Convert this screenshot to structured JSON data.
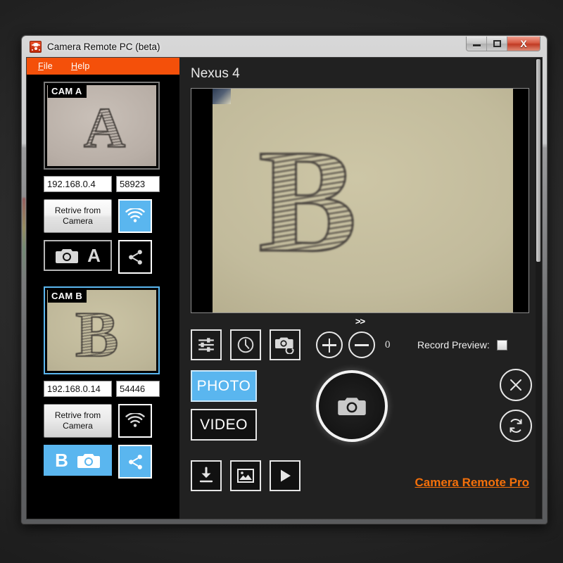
{
  "window": {
    "title": "Camera Remote PC (beta)",
    "app_icon": "camera-app-icon",
    "controls": {
      "minimize": "minimize-icon",
      "maximize": "maximize-icon",
      "close": "X"
    }
  },
  "menu": {
    "items": [
      {
        "label": "File",
        "mnemonic": "F"
      },
      {
        "label": "Help",
        "mnemonic": "H"
      }
    ]
  },
  "sidebar": {
    "cameras": [
      {
        "badge": "CAM A",
        "letter": "A",
        "selected": false,
        "ip": "192.168.0.4",
        "port": "58923",
        "retrieve_label": "Retrive from\nCamera",
        "wifi_active": true,
        "capture_letter": "A",
        "capture_active": false,
        "share_active": false
      },
      {
        "badge": "CAM B",
        "letter": "B",
        "selected": true,
        "ip": "192.168.0.14",
        "port": "54446",
        "retrieve_label": "Retrive from\nCamera",
        "wifi_active": false,
        "capture_letter": "B",
        "capture_active": true,
        "share_active": true
      }
    ]
  },
  "main": {
    "device_title": "Nexus 4",
    "preview_letter": "B",
    "chevron": ">>",
    "controls": {
      "settings_icon": "sliders-icon",
      "timer_icon": "clock-icon",
      "switch_camera_icon": "camera-switch-icon",
      "zoom_in": "plus-icon",
      "zoom_out": "minus-icon",
      "zoom_value": "0",
      "record_preview_label": "Record Preview:",
      "record_preview_checked": false
    },
    "modes": [
      {
        "label": "PHOTO",
        "active": true
      },
      {
        "label": "VIDEO",
        "active": false
      }
    ],
    "shutter_icon": "camera-icon",
    "side_buttons": [
      {
        "icon": "close-circle-icon"
      },
      {
        "icon": "refresh-circle-icon"
      }
    ],
    "bottom_buttons": [
      {
        "icon": "download-icon"
      },
      {
        "icon": "gallery-icon"
      },
      {
        "icon": "play-icon"
      }
    ],
    "pro_link": "Camera Remote Pro"
  },
  "colors": {
    "accent_orange": "#f4500a",
    "accent_blue": "#5ab6ef",
    "pro_link": "#f4700a",
    "panel_bg": "#212121",
    "sidebar_bg": "#000000"
  }
}
